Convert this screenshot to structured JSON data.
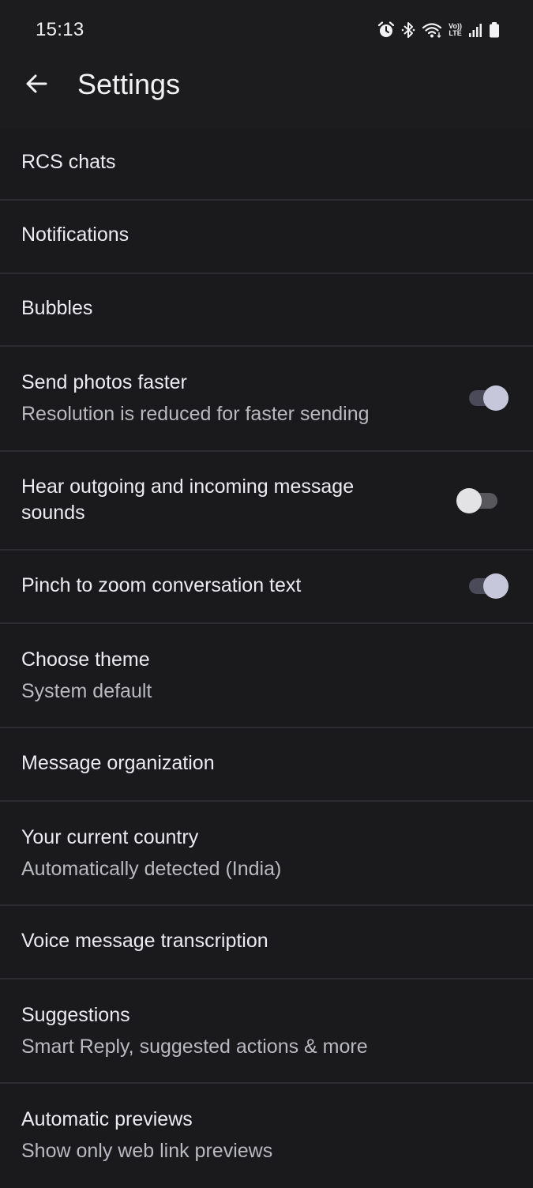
{
  "status_bar": {
    "time": "15:13",
    "icons": [
      "alarm-icon",
      "bluetooth-icon",
      "wifi-icon",
      "volte-icon",
      "signal-icon",
      "battery-icon"
    ],
    "volte_top": "Vo))",
    "volte_bottom": "LTE"
  },
  "app_bar": {
    "back_icon": "arrow-back-icon",
    "title": "Settings"
  },
  "settings": [
    {
      "title": "RCS chats"
    },
    {
      "title": "Notifications"
    },
    {
      "title": "Bubbles"
    },
    {
      "title": "Send photos faster",
      "subtitle": "Resolution is reduced for faster sending",
      "toggle": true
    },
    {
      "title_line1": "Hear outgoing and incoming message",
      "title_line2": "sounds",
      "toggle": false
    },
    {
      "title": "Pinch to zoom conversation text",
      "toggle": true
    },
    {
      "title": "Choose theme",
      "subtitle": "System default"
    },
    {
      "title": "Message organization"
    },
    {
      "title": "Your current country",
      "subtitle": "Automatically detected (India)"
    },
    {
      "title": "Voice message transcription"
    },
    {
      "title": "Suggestions",
      "subtitle": "Smart Reply, suggested actions & more"
    },
    {
      "title": "Automatic previews",
      "subtitle": "Show only web link previews"
    }
  ],
  "colors": {
    "background": "#1a1a1c",
    "divider": "#2c2c30",
    "toggle_on_thumb": "#c7c7dc",
    "toggle_off_thumb": "#e3e3e6"
  }
}
